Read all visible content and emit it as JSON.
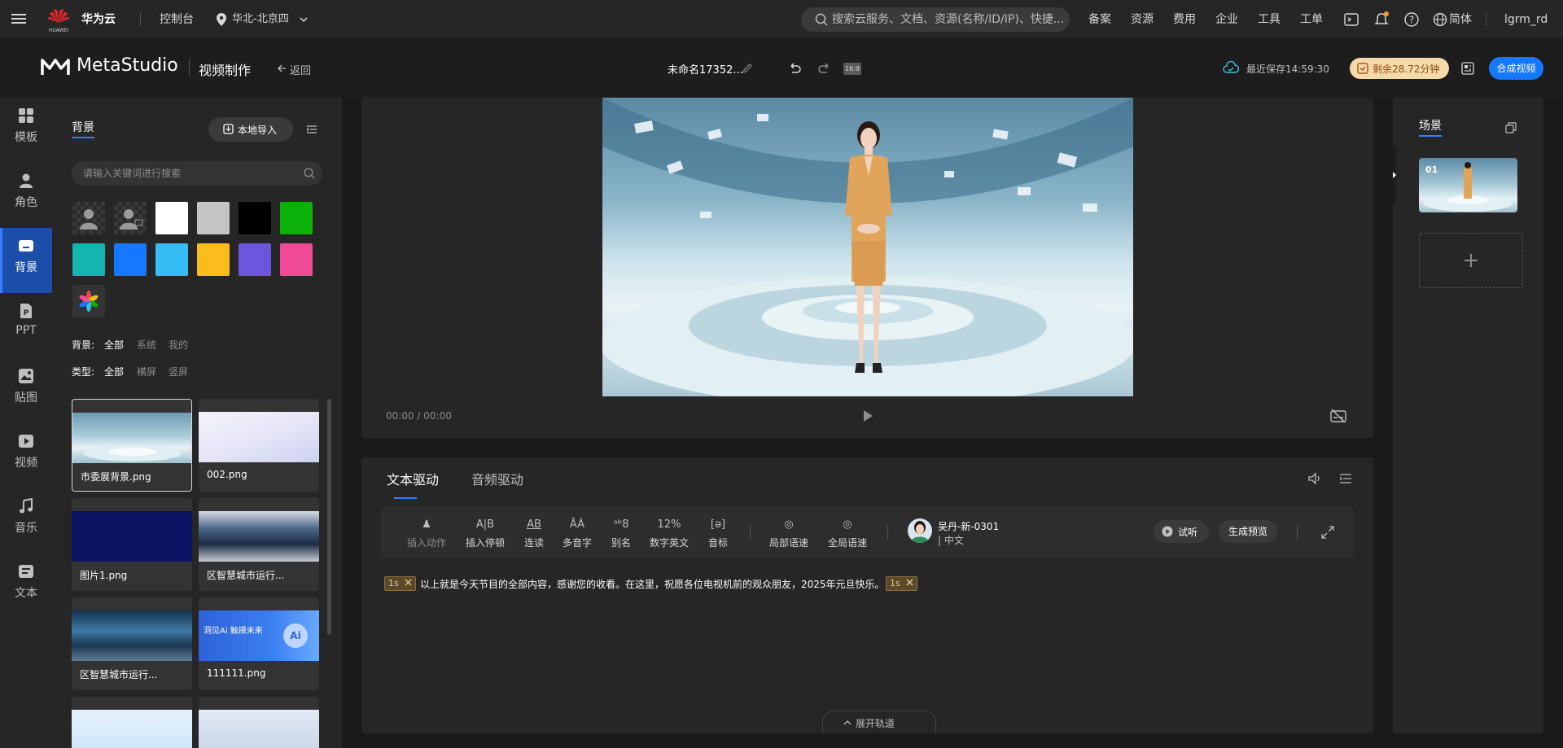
{
  "topbar": {
    "brand": "华为云",
    "brand_sub": "HUAWEI",
    "console": "控制台",
    "region": "华北-北京四",
    "search_placeholder": "搜索云服务、文档、资源(名称/ID/IP)、快捷...",
    "nav": [
      "备案",
      "资源",
      "费用",
      "企业",
      "工具",
      "工单"
    ],
    "lang": "简体",
    "user": "lgrm_rd"
  },
  "header": {
    "app_name": "MetaStudio",
    "section": "视频制作",
    "back": "返回",
    "doc_title": "未命名17352...",
    "ratio": "16:9",
    "save_status": "最近保存14:59:30",
    "remaining": "剩余28.72分钟",
    "compose_button": "合成视频"
  },
  "rail": [
    {
      "label": "模板",
      "icon": "template-icon"
    },
    {
      "label": "角色",
      "icon": "role-icon"
    },
    {
      "label": "背景",
      "icon": "background-icon",
      "active": true
    },
    {
      "label": "PPT",
      "icon": "ppt-icon"
    },
    {
      "label": "贴图",
      "icon": "sticker-icon"
    },
    {
      "label": "视频",
      "icon": "video-icon"
    },
    {
      "label": "音乐",
      "icon": "music-icon"
    },
    {
      "label": "文本",
      "icon": "text-icon"
    }
  ],
  "bgpanel": {
    "tab": "背景",
    "import_button": "本地导入",
    "search_placeholder": "请输入关键词进行搜索",
    "swatch_colors": [
      "#ffffff",
      "#c4c4c4",
      "#000000",
      "#0bb00b",
      "#12b5b0",
      "#1677ff",
      "#36bdf5",
      "#fbbd1c",
      "#6e55e0",
      "#ef4b95"
    ],
    "filter_bg_label": "背景:",
    "filter_bg_options": [
      "全部",
      "系统",
      "我的"
    ],
    "filter_type_label": "类型:",
    "filter_type_options": [
      "全部",
      "横屏",
      "竖屏"
    ],
    "thumbs": [
      {
        "name": "市委展背景.png"
      },
      {
        "name": "002.png"
      },
      {
        "name": "图片1.png"
      },
      {
        "name": "区智慧城市运行..."
      },
      {
        "name": "区智慧城市运行..."
      },
      {
        "name": "111111.png"
      }
    ],
    "banner_text_1": "洞见Ai 触摸未来",
    "banner_text_2": "Ai"
  },
  "preview": {
    "time": "00:00 / 00:00"
  },
  "editor": {
    "tabs": [
      "文本驱动",
      "音频驱动"
    ],
    "tools": [
      {
        "glyph": "♟",
        "label": "插入动作"
      },
      {
        "glyph": "A|B",
        "label": "插入停顿"
      },
      {
        "glyph": "AB",
        "label": "连读"
      },
      {
        "glyph": "ĀÁ",
        "label": "多音字"
      },
      {
        "glyph": "ᵃᵇ8",
        "label": "别名"
      },
      {
        "glyph": "12%",
        "label": "数字英文"
      },
      {
        "glyph": "[ə]",
        "label": "音标"
      },
      {
        "glyph": "◎",
        "label": "局部语速"
      },
      {
        "glyph": "◎",
        "label": "全局语速"
      }
    ],
    "voice_name": "吴丹-新-0301",
    "voice_lang": "| 中文",
    "listen_button": "试听",
    "preview_button": "生成预览",
    "pause_tag": "1s",
    "script_text": "以上就是今天节目的全部内容，感谢您的收看。在这里，祝愿各位电视机前的观众朋友，2025年元旦快乐。",
    "expand_track": "展开轨道"
  },
  "scenes": {
    "tab": "场景",
    "scene_index": "01"
  }
}
